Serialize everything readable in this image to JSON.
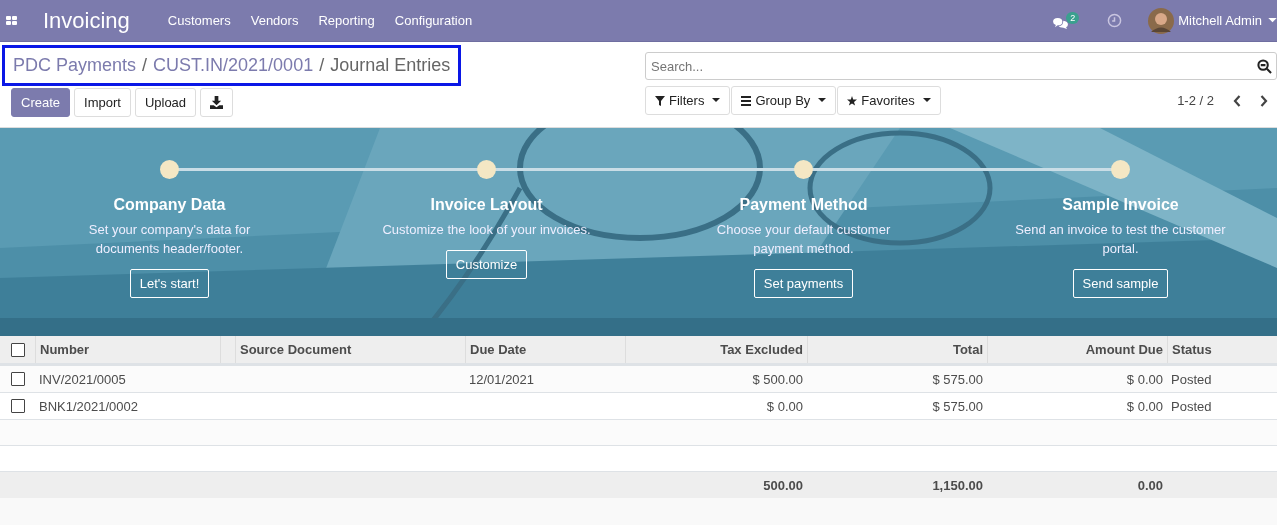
{
  "navbar": {
    "app_title": "Invoicing",
    "menu": [
      "Customers",
      "Vendors",
      "Reporting",
      "Configuration"
    ],
    "messages_count": "2",
    "user": "Mitchell Admin"
  },
  "breadcrumb": {
    "highlighted": true,
    "separator": "/",
    "items": [
      "PDC Payments",
      "CUST.IN/2021/0001",
      "Journal Entries"
    ]
  },
  "actions": [
    "Create",
    "Import",
    "Upload"
  ],
  "search": {
    "placeholder": "Search..."
  },
  "filters": [
    "Filters",
    "Group By",
    "Favorites"
  ],
  "pager": "1-2 / 2",
  "onboarding": [
    {
      "title": "Company Data",
      "text": "Set your company's data for documents header/footer.",
      "button": "Let's start!"
    },
    {
      "title": "Invoice Layout",
      "text": "Customize the look of your invoices.",
      "button": "Customize"
    },
    {
      "title": "Payment Method",
      "text": "Choose your default customer payment method.",
      "button": "Set payments"
    },
    {
      "title": "Sample Invoice",
      "text": "Send an invoice to test the customer portal.",
      "button": "Send sample"
    }
  ],
  "table": {
    "all_checked": false,
    "columns": [
      "Number",
      "Source Document",
      "Due Date",
      "Tax Excluded",
      "Total",
      "Amount Due",
      "Status"
    ],
    "rows": [
      {
        "checked": false,
        "cells": [
          "INV/2021/0005",
          "",
          "12/01/2021",
          "$ 500.00",
          "$ 575.00",
          "$ 0.00",
          "Posted"
        ]
      },
      {
        "checked": false,
        "cells": [
          "BNK1/2021/0002",
          "",
          "",
          "$ 0.00",
          "$ 575.00",
          "$ 0.00",
          "Posted"
        ]
      }
    ],
    "totals": [
      "500.00",
      "1,150.00",
      "0.00"
    ]
  }
}
